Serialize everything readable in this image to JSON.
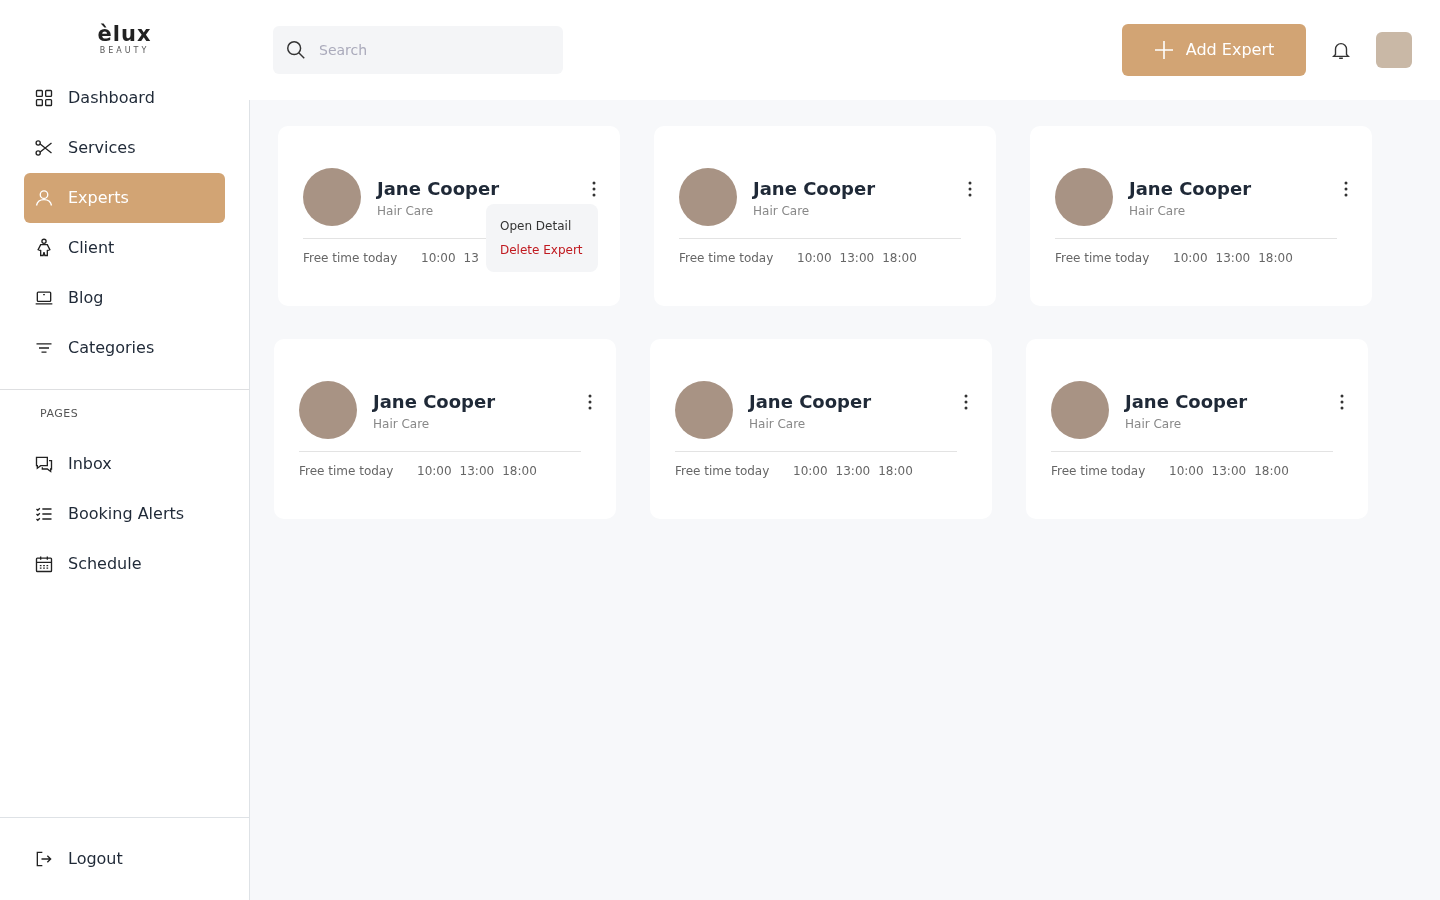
{
  "logo": {
    "name": "èlux",
    "tagline": "BEAUTY"
  },
  "sidebar": {
    "items": [
      {
        "label": "Dashboard",
        "selected": false
      },
      {
        "label": "Services",
        "selected": false
      },
      {
        "label": "Experts",
        "selected": true
      },
      {
        "label": "Client",
        "selected": false
      },
      {
        "label": "Blog",
        "selected": false
      },
      {
        "label": "Categories",
        "selected": false
      }
    ],
    "section_title": "PAGES",
    "pages": [
      {
        "label": "Inbox",
        "selected": false
      },
      {
        "label": "Booking Alerts",
        "selected": false
      },
      {
        "label": "Schedule",
        "selected": false
      }
    ],
    "logout": "Logout"
  },
  "search": {
    "placeholder": "Search"
  },
  "add_button": "Add Expert",
  "experts": [
    {
      "name": "Jane Cooper",
      "role": "Hair Care",
      "free_label": "Free time today",
      "times": [
        "10:00",
        "13"
      ],
      "menu_open": true
    },
    {
      "name": "Jane Cooper",
      "role": "Hair Care",
      "free_label": "Free time today",
      "times": [
        "10:00",
        "13:00",
        "18:00"
      ],
      "menu_open": false
    },
    {
      "name": "Jane Cooper",
      "role": "Hair Care",
      "free_label": "Free time today",
      "times": [
        "10:00",
        "13:00",
        "18:00"
      ],
      "menu_open": false
    },
    {
      "name": "Jane Cooper",
      "role": "Hair Care",
      "free_label": "Free time today",
      "times": [
        "10:00",
        "13:00",
        "18:00"
      ],
      "menu_open": false
    },
    {
      "name": "Jane Cooper",
      "role": "Hair Care",
      "free_label": "Free time today",
      "times": [
        "10:00",
        "13:00",
        "18:00"
      ],
      "menu_open": false
    },
    {
      "name": "Jane Cooper",
      "role": "Hair Care",
      "free_label": "Free time today",
      "times": [
        "10:00",
        "13:00",
        "18:00"
      ],
      "menu_open": false
    }
  ],
  "menu": [
    {
      "label": "Open Detail",
      "kind": "normal"
    },
    {
      "label": "Delete Expert",
      "kind": "danger"
    }
  ]
}
